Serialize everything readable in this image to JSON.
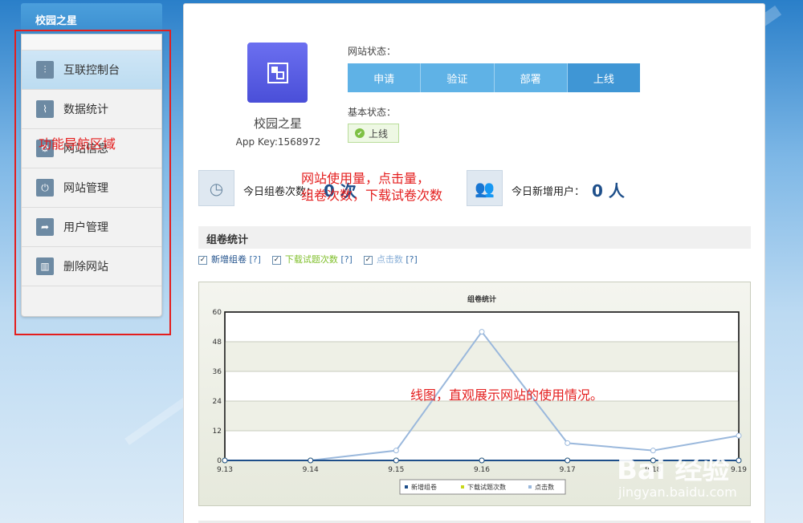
{
  "sidebar": {
    "title": "校园之星",
    "items": [
      {
        "label": "互联控制台",
        "icon": "sliders-icon"
      },
      {
        "label": "数据统计",
        "icon": "chart-icon"
      },
      {
        "label": "网站信息",
        "icon": "gear-icon"
      },
      {
        "label": "网站管理",
        "icon": "plug-icon"
      },
      {
        "label": "用户管理",
        "icon": "share-icon"
      },
      {
        "label": "删除网站",
        "icon": "trash-icon"
      }
    ]
  },
  "annotations": {
    "nav_area": "功能导航区域",
    "usage_line1": "网站使用量，点击量，",
    "usage_line2": "组卷次数，下载试卷次数",
    "chart_note": "线图，直观展示网站的使用情况。"
  },
  "app": {
    "name": "校园之星",
    "app_key": "App Key:1568972"
  },
  "site_status": {
    "label": "网站状态：",
    "steps": [
      "申请",
      "验证",
      "部署",
      "上线"
    ],
    "basic_label": "基本状态：",
    "basic_value": "上线"
  },
  "stats": {
    "today_papers_label": "今日组卷次数：",
    "today_papers_value": "0 次",
    "today_users_label": "今日新增用户：",
    "today_users_value": "0 人"
  },
  "section": {
    "title": "组卷统计",
    "legend": [
      {
        "label": "新增组卷",
        "help": "[?]",
        "color": "#1e4f8a"
      },
      {
        "label": "下载试题次数",
        "help": "[?]",
        "color": "#7fbf2a"
      },
      {
        "label": "点击数",
        "help": "[?]",
        "color": "#8ab0d8"
      }
    ]
  },
  "chart_data": {
    "type": "line",
    "title": "组卷统计",
    "x": [
      "9.13",
      "9.14",
      "9.15",
      "9.16",
      "9.17",
      "9.18",
      "9.19"
    ],
    "ylim": [
      0,
      60
    ],
    "yticks": [
      0,
      12,
      24,
      36,
      48,
      60
    ],
    "grid": true,
    "legend_placement": "bottom",
    "series": [
      {
        "name": "新增组卷",
        "color": "#1e4f8a",
        "values": [
          0,
          0,
          0,
          0,
          0,
          0,
          0
        ]
      },
      {
        "name": "下载试题次数",
        "color": "#c8d81a",
        "values": [
          0,
          0,
          0,
          0,
          0,
          0,
          0
        ]
      },
      {
        "name": "点击数",
        "color": "#9ab8dc",
        "values": [
          0,
          0,
          4,
          52,
          7,
          4,
          10
        ]
      }
    ]
  },
  "watermark": {
    "brand": "Bai 经验",
    "url": "jingyan.baidu.com"
  }
}
